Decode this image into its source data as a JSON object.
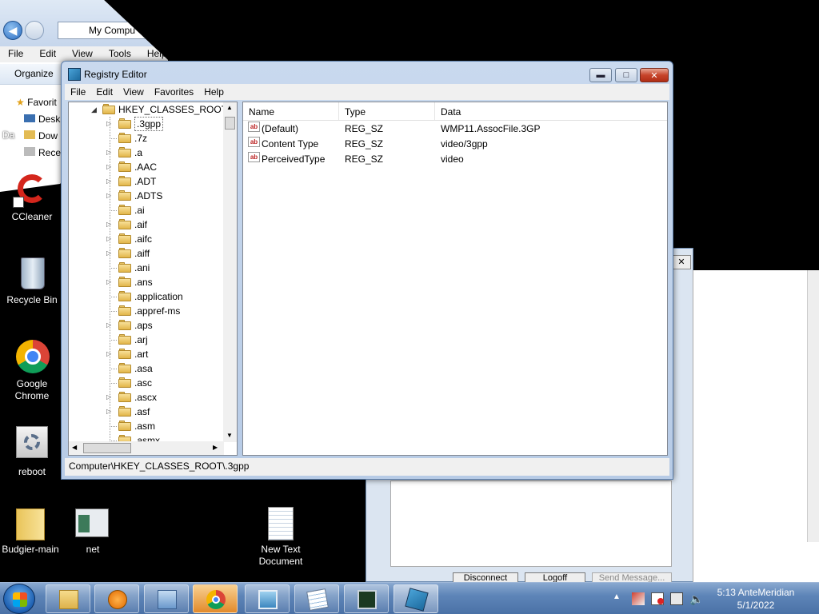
{
  "explorer": {
    "address": "My Compu",
    "menu": [
      "File",
      "Edit",
      "View",
      "Tools",
      "Help"
    ],
    "organize": "Organize",
    "nav": [
      "Favorit",
      "Desk",
      "Dow",
      "Rece"
    ],
    "cut_label": "Da"
  },
  "desktop_icons": [
    {
      "name": "ccleaner",
      "label": "CCleaner"
    },
    {
      "name": "recycle-bin",
      "label": "Recycle Bin"
    },
    {
      "name": "google-chrome",
      "label": "Google Chrome"
    },
    {
      "name": "reboot",
      "label": "reboot"
    },
    {
      "name": "budgier-main",
      "label": "Budgier-main"
    },
    {
      "name": "net",
      "label": "net"
    },
    {
      "name": "new-text-document",
      "label": "New Text Document"
    }
  ],
  "backdialog": {
    "buttons": [
      "Disconnect",
      "Logoff",
      "Send Message..."
    ]
  },
  "regedit": {
    "title": "Registry Editor",
    "menu": [
      "File",
      "Edit",
      "View",
      "Favorites",
      "Help"
    ],
    "root": "HKEY_CLASSES_ROOT",
    "tree": [
      {
        "label": ".3gpp",
        "exp": true,
        "selected": true
      },
      {
        "label": ".7z",
        "exp": false
      },
      {
        "label": ".a",
        "exp": true
      },
      {
        "label": ".AAC",
        "exp": true
      },
      {
        "label": ".ADT",
        "exp": true
      },
      {
        "label": ".ADTS",
        "exp": true
      },
      {
        "label": ".ai",
        "exp": false
      },
      {
        "label": ".aif",
        "exp": true
      },
      {
        "label": ".aifc",
        "exp": true
      },
      {
        "label": ".aiff",
        "exp": true
      },
      {
        "label": ".ani",
        "exp": false
      },
      {
        "label": ".ans",
        "exp": true
      },
      {
        "label": ".application",
        "exp": false
      },
      {
        "label": ".appref-ms",
        "exp": false
      },
      {
        "label": ".aps",
        "exp": true
      },
      {
        "label": ".arj",
        "exp": false
      },
      {
        "label": ".art",
        "exp": true
      },
      {
        "label": ".asa",
        "exp": false
      },
      {
        "label": ".asc",
        "exp": false
      },
      {
        "label": ".ascx",
        "exp": true
      },
      {
        "label": ".asf",
        "exp": true
      },
      {
        "label": ".asm",
        "exp": false
      },
      {
        "label": ".asmx",
        "exp": false
      }
    ],
    "columns": [
      "Name",
      "Type",
      "Data"
    ],
    "values": [
      {
        "name": "(Default)",
        "type": "REG_SZ",
        "data": "WMP11.AssocFile.3GP"
      },
      {
        "name": "Content Type",
        "type": "REG_SZ",
        "data": "video/3gpp"
      },
      {
        "name": "PerceivedType",
        "type": "REG_SZ",
        "data": "video"
      }
    ],
    "status": "Computer\\HKEY_CLASSES_ROOT\\.3gpp"
  },
  "taskbar": {
    "apps": [
      "windows-explorer",
      "media-player",
      "control-panel",
      "google-chrome",
      "photo-viewer",
      "notepad",
      "task-manager",
      "registry-editor"
    ],
    "time": "5:13 AnteMeridian",
    "date": "5/1/2022"
  }
}
